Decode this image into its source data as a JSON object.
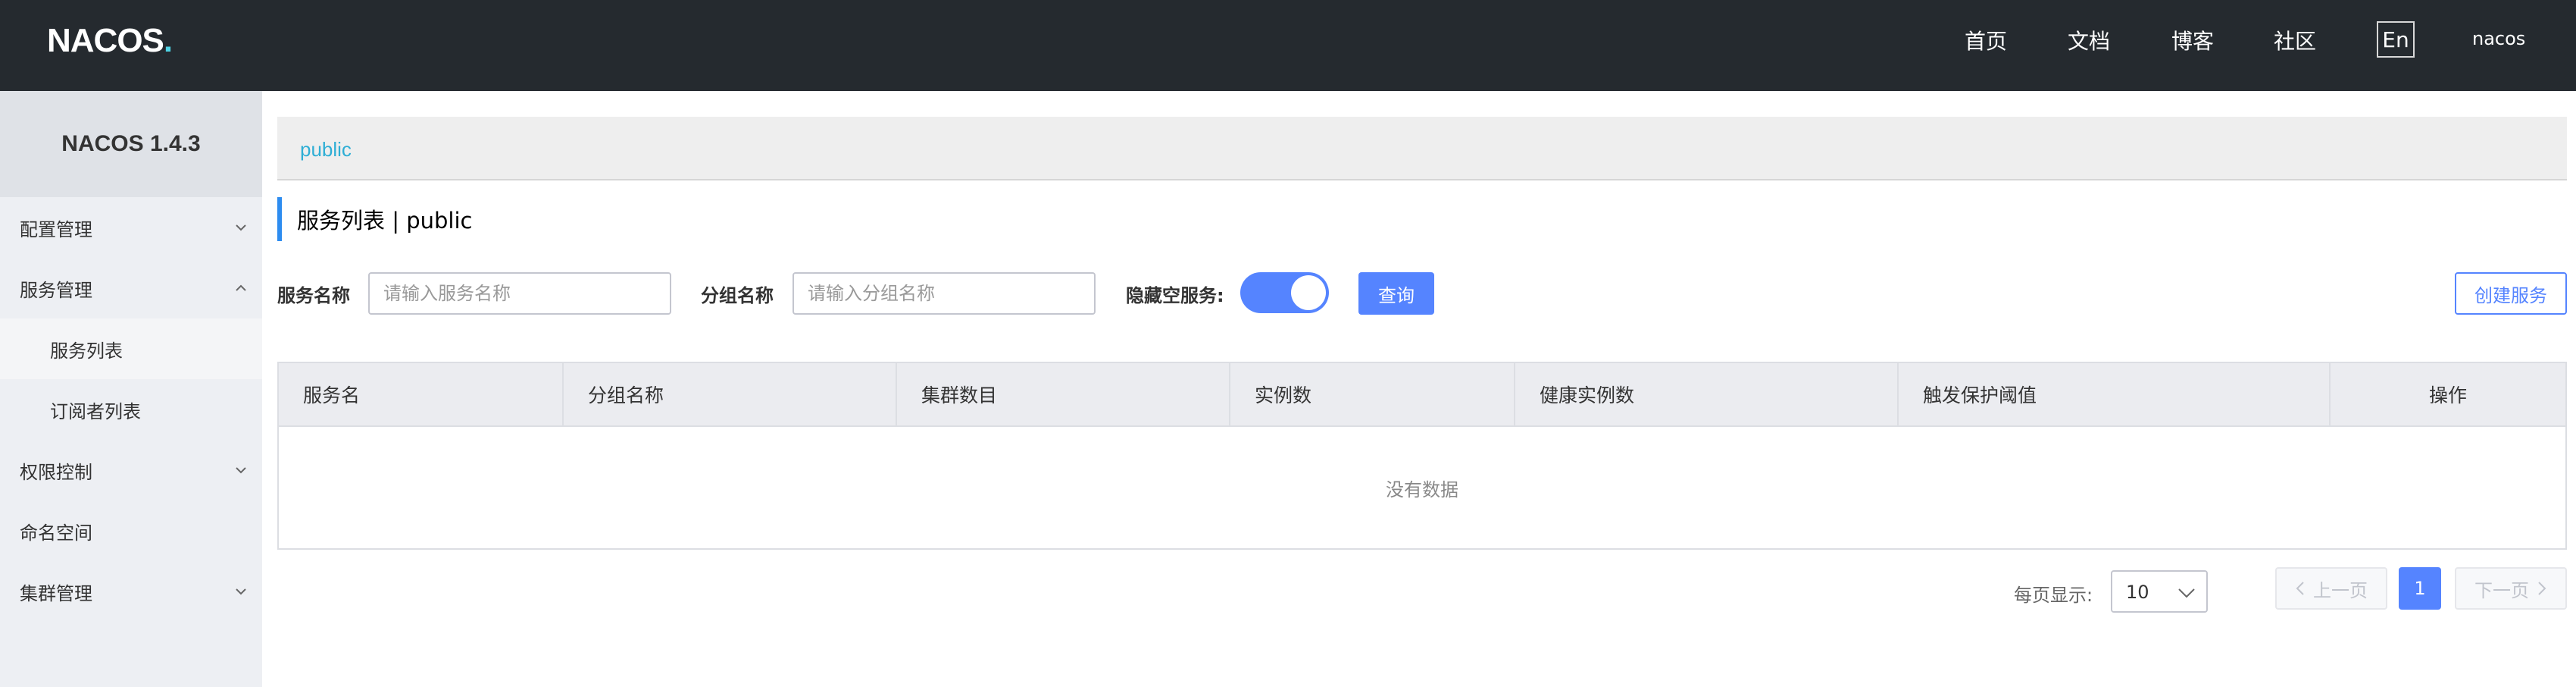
{
  "header": {
    "logo": "NACOS",
    "logo_dot": ".",
    "nav": [
      "首页",
      "文档",
      "博客",
      "社区"
    ],
    "lang_button": "En",
    "username": "nacos"
  },
  "sidebar": {
    "version": "NACOS 1.4.3",
    "items": [
      {
        "label": "配置管理",
        "chevron": "down"
      },
      {
        "label": "服务管理",
        "chevron": "up"
      },
      {
        "label": "服务列表"
      },
      {
        "label": "订阅者列表"
      },
      {
        "label": "权限控制",
        "chevron": "down"
      },
      {
        "label": "命名空间"
      },
      {
        "label": "集群管理",
        "chevron": "down"
      }
    ]
  },
  "main": {
    "namespace": "public",
    "title": "服务列表  |  public",
    "search": {
      "service_name_label": "服务名称",
      "service_name_placeholder": "请输入服务名称",
      "group_name_label": "分组名称",
      "group_name_placeholder": "请输入分组名称",
      "hide_empty_label": "隐藏空服务:",
      "hide_empty_on": true,
      "query_button": "查询",
      "create_button": "创建服务"
    },
    "table": {
      "columns": [
        "服务名",
        "分组名称",
        "集群数目",
        "实例数",
        "健康实例数",
        "触发保护阈值",
        "操作"
      ],
      "empty_text": "没有数据"
    },
    "pagination": {
      "page_size_label": "每页显示:",
      "page_size": "10",
      "prev": "上一页",
      "next": "下一页",
      "current_page": "1"
    }
  },
  "colors": {
    "header_bg": "#252a2f",
    "accent": "#5584ff",
    "sidebar_bg": "#edeff3",
    "link": "#2eaed5"
  }
}
